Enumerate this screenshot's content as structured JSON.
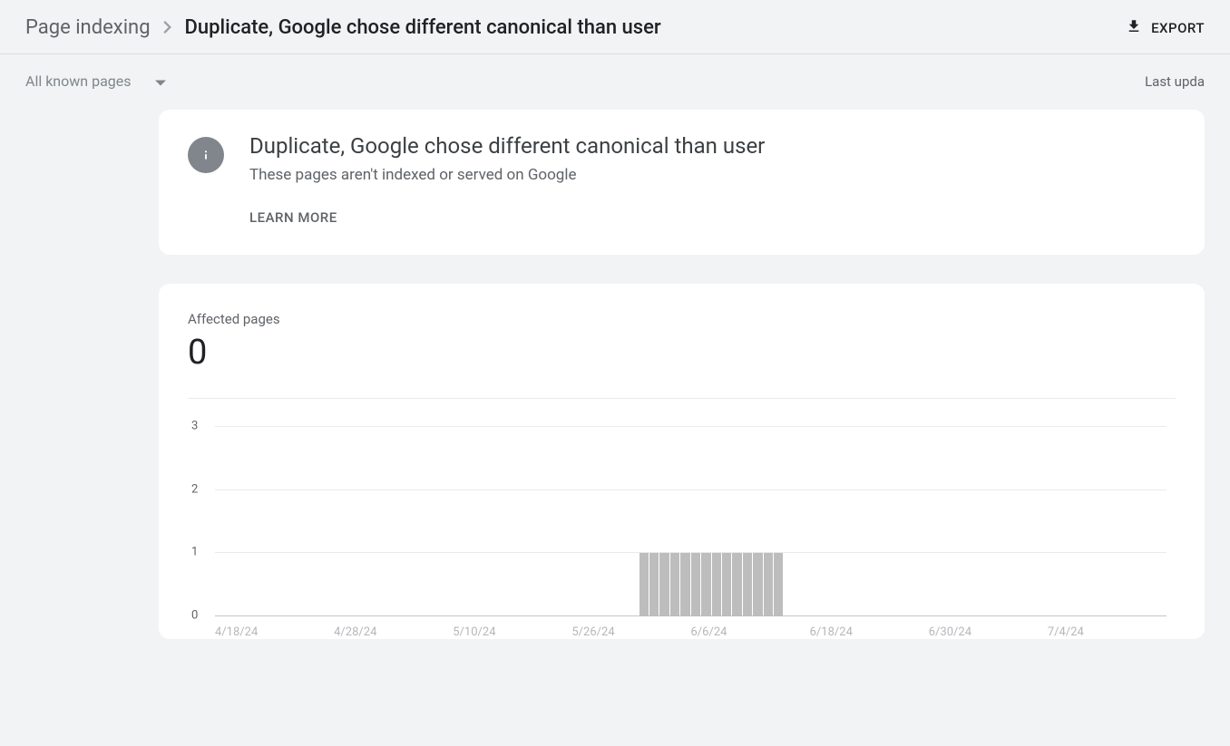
{
  "breadcrumb": {
    "parent": "Page indexing",
    "current": "Duplicate, Google chose different canonical than user"
  },
  "export_label": "EXPORT",
  "filter": {
    "selected": "All known pages"
  },
  "last_updated_label": "Last upda",
  "info": {
    "title": "Duplicate, Google chose different canonical than user",
    "subtitle": "These pages aren't indexed or served on Google",
    "learn_more": "LEARN MORE"
  },
  "affected": {
    "label": "Affected pages",
    "value": "0"
  },
  "chart_data": {
    "type": "bar",
    "ylabel": "",
    "ylim": [
      0,
      3
    ],
    "yticks": [
      0,
      1,
      2,
      3
    ],
    "categories": [
      "4/18/24",
      "4/28/24",
      "5/10/24",
      "5/26/24",
      "6/6/24",
      "6/18/24",
      "6/30/24",
      "7/4/24"
    ],
    "values": [
      0,
      0,
      0,
      0,
      0,
      0,
      0,
      0,
      0,
      0,
      0,
      0,
      0,
      0,
      0,
      0,
      0,
      0,
      0,
      0,
      0,
      0,
      0,
      0,
      0,
      0,
      0,
      0,
      0,
      0,
      0,
      0,
      0,
      0,
      0,
      0,
      0,
      0,
      0,
      0,
      0,
      1,
      1,
      1,
      1,
      1,
      1,
      1,
      1,
      1,
      1,
      1,
      1,
      1,
      1,
      0,
      0,
      0,
      0,
      0,
      0,
      0,
      0,
      0,
      0,
      0,
      0,
      0,
      0,
      0,
      0,
      0,
      0,
      0,
      0,
      0,
      0,
      0,
      0,
      0,
      0,
      0,
      0,
      0,
      0,
      0,
      0,
      0,
      0,
      0,
      0,
      0
    ]
  }
}
